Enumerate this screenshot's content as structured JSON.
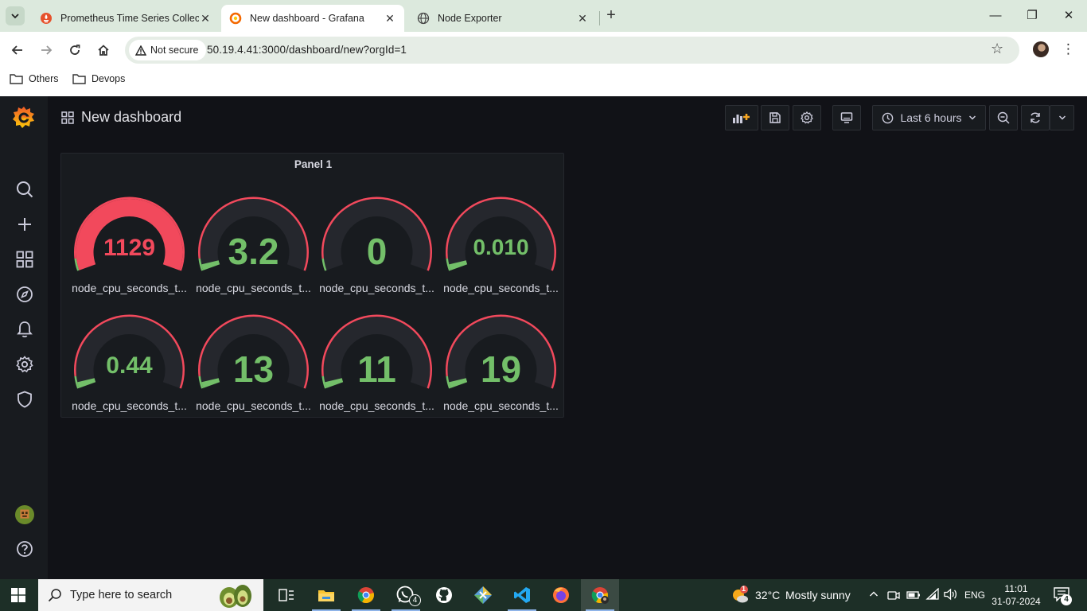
{
  "browser": {
    "tabs": [
      {
        "title": "Prometheus Time Series Collecti",
        "active": false
      },
      {
        "title": "New dashboard - Grafana",
        "active": true
      },
      {
        "title": "Node Exporter",
        "active": false
      }
    ],
    "security_label": "Not secure",
    "url": "50.19.4.41:3000/dashboard/new?orgId=1",
    "bookmarks": [
      "Others",
      "Devops"
    ]
  },
  "grafana": {
    "dashboard_title": "New dashboard",
    "time_range": "Last 6 hours",
    "panel": {
      "title": "Panel 1",
      "gauges": [
        {
          "value": "1129",
          "fraction": 1.0,
          "color": "#f2495c",
          "label": "node_cpu_seconds_t..."
        },
        {
          "value": "3.2",
          "fraction": 0.03,
          "color": "#73bf69",
          "label": "node_cpu_seconds_t..."
        },
        {
          "value": "0",
          "fraction": 0.0,
          "color": "#73bf69",
          "label": "node_cpu_seconds_t..."
        },
        {
          "value": "0.010",
          "fraction": 0.03,
          "color": "#73bf69",
          "label": "node_cpu_seconds_t..."
        },
        {
          "value": "0.44",
          "fraction": 0.03,
          "color": "#73bf69",
          "label": "node_cpu_seconds_t..."
        },
        {
          "value": "13",
          "fraction": 0.03,
          "color": "#73bf69",
          "label": "node_cpu_seconds_t..."
        },
        {
          "value": "11",
          "fraction": 0.03,
          "color": "#73bf69",
          "label": "node_cpu_seconds_t..."
        },
        {
          "value": "19",
          "fraction": 0.03,
          "color": "#73bf69",
          "label": "node_cpu_seconds_t..."
        }
      ]
    }
  },
  "taskbar": {
    "search_placeholder": "Type here to search",
    "whatsapp_badge": "4",
    "temperature": "32°C",
    "weather": "Mostly sunny",
    "weather_alert": "1",
    "language": "ENG",
    "time": "11:01",
    "date": "31-07-2024",
    "notifications": "4"
  },
  "colors": {
    "threshold_red": "#f2495c",
    "ok_green": "#73bf69",
    "grafana_bg": "#111217",
    "panel_bg": "#181b1f"
  }
}
